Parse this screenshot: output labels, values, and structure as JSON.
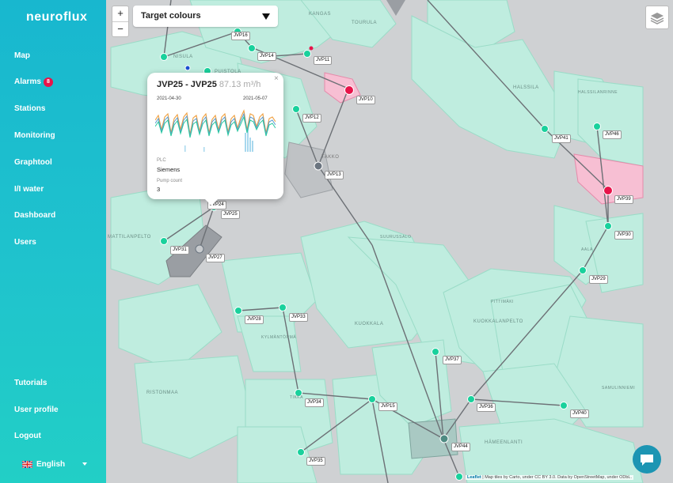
{
  "app": {
    "logo": "neuroflux"
  },
  "nav": {
    "items": [
      {
        "label": "Map",
        "name": "nav-map"
      },
      {
        "label": "Alarms",
        "name": "nav-alarms",
        "badge": "8"
      },
      {
        "label": "Stations",
        "name": "nav-stations"
      },
      {
        "label": "Monitoring",
        "name": "nav-monitoring"
      },
      {
        "label": "Graphtool",
        "name": "nav-graphtool"
      },
      {
        "label": "I/I water",
        "name": "nav-ii-water"
      },
      {
        "label": "Dashboard",
        "name": "nav-dashboard"
      },
      {
        "label": "Users",
        "name": "nav-users"
      }
    ],
    "bottom": [
      {
        "label": "Tutorials",
        "name": "nav-tutorials"
      },
      {
        "label": "User profile",
        "name": "nav-user-profile"
      },
      {
        "label": "Logout",
        "name": "nav-logout"
      }
    ],
    "language": "English"
  },
  "map": {
    "zoom_in": "+",
    "zoom_out": "−",
    "select_value": "Target colours",
    "place_names": [
      "KANGAS",
      "TOURULA",
      "NISULA",
      "PUISTOLA",
      "HALSSILA",
      "HALSSILANRINNE",
      "TAKKO",
      "MATTILANPELTO",
      "SUURUSSALO",
      "AALA",
      "PITTIMÄKI",
      "KUOKKALANPELTO",
      "KUOKKALA",
      "RISTONMAA",
      "TIKKA",
      "KYLMÄNTÖRMÄ",
      "SAMULINNIEMI",
      "HÄMEENLANTI"
    ],
    "attribution_leaflet": "Leaflet",
    "attribution": "| Map tiles by Carto, under CC BY 3.0. Data by OpenStreetMap, under ODbL."
  },
  "popup": {
    "title": "JVP25 - JVP25",
    "flow": "87.13 m³/h",
    "date_start": "2021-04-30",
    "date_end": "2021-05-07",
    "plc_label": "PLC",
    "plc_value": "Siemens",
    "pump_label": "Pump count",
    "pump_value": "3",
    "close": "×"
  },
  "stations": [
    {
      "id": "JVP16"
    },
    {
      "id": "JVP14"
    },
    {
      "id": "JVP11"
    },
    {
      "id": "JVP10"
    },
    {
      "id": "JVP12"
    },
    {
      "id": "JVP13"
    },
    {
      "id": "JVP41"
    },
    {
      "id": "JVP46"
    },
    {
      "id": "JVP39"
    },
    {
      "id": "JVP30"
    },
    {
      "id": "JVP29"
    },
    {
      "id": "JVP24"
    },
    {
      "id": "JVP25"
    },
    {
      "id": "JVP31"
    },
    {
      "id": "JVP27"
    },
    {
      "id": "JVP28"
    },
    {
      "id": "JVP33"
    },
    {
      "id": "JVP37"
    },
    {
      "id": "JVP34"
    },
    {
      "id": "JVP15"
    },
    {
      "id": "JVP36"
    },
    {
      "id": "JVP40"
    },
    {
      "id": "JVP44"
    },
    {
      "id": "JVP35"
    }
  ],
  "colors": {
    "sidebar": "#1fc3cd",
    "area": "#bfeddf",
    "station": "#19d19c",
    "alarm": "#e8134a",
    "offline": "#6b7580"
  }
}
